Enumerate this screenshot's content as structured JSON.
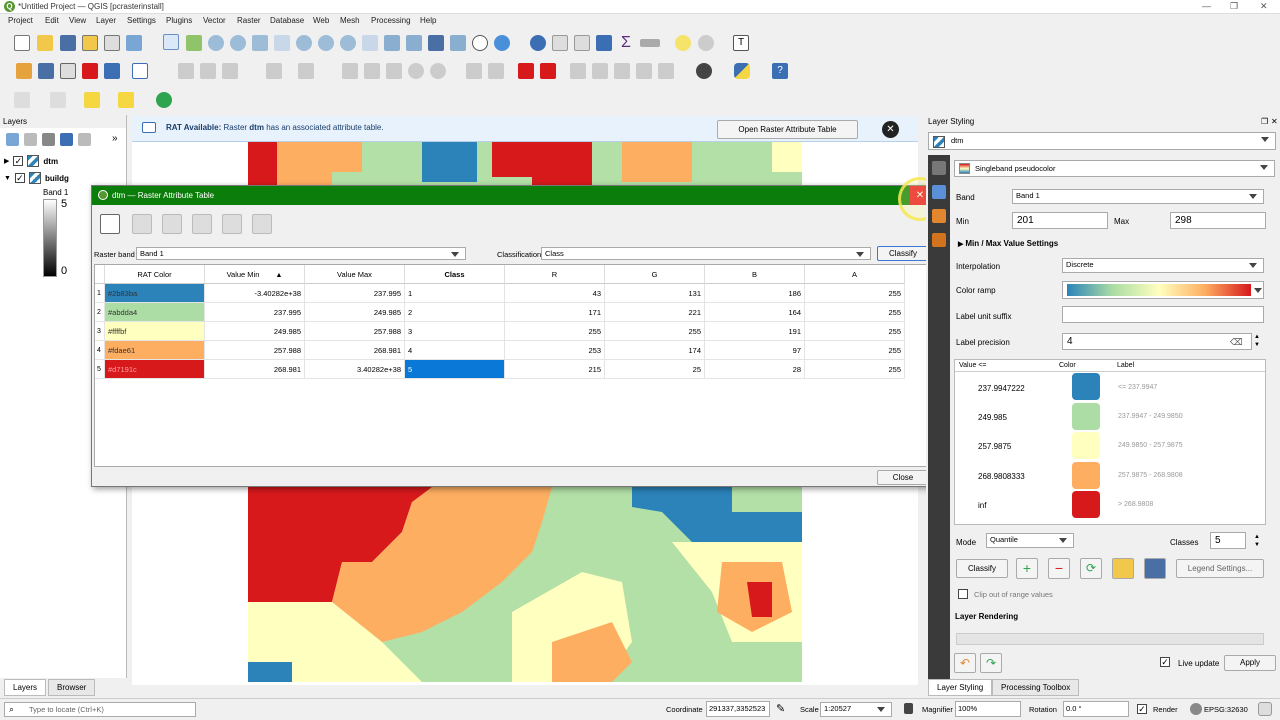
{
  "window": {
    "title": "*Untitled Project — QGIS [pcrasterinstall]"
  },
  "menu": [
    "Project",
    "Edit",
    "View",
    "Layer",
    "Settings",
    "Plugins",
    "Vector",
    "Raster",
    "Database",
    "Web",
    "Mesh",
    "Processing",
    "Help"
  ],
  "layers_panel": {
    "title": "Layers",
    "items": [
      {
        "name": "dtm",
        "checked": true
      },
      {
        "name": "buildg",
        "checked": true
      }
    ],
    "legend": {
      "band": "Band 1",
      "max": "5",
      "min": "0"
    },
    "tabs": [
      "Layers",
      "Browser"
    ]
  },
  "message_bar": {
    "bold": "RAT Available:",
    "text": " Raster ",
    "layer": "dtm",
    "rest": " has an associated attribute table.",
    "button": "Open Raster Attribute Table"
  },
  "dialog": {
    "title": "dtm — Raster Attribute Table",
    "raster_band_label": "Raster band",
    "raster_band": "Band 1",
    "classification_label": "Classification",
    "classification": "Class",
    "classify_button": "Classify",
    "close_button": "Close",
    "columns": [
      "RAT Color",
      "Value Min",
      "Value Max",
      "Class",
      "R",
      "G",
      "B",
      "A"
    ],
    "rows": [
      {
        "n": "1",
        "color": "#2b83ba",
        "min": "-3.40282e+38",
        "max": "237.995",
        "class": "1",
        "r": "43",
        "g": "131",
        "b": "186",
        "a": "255"
      },
      {
        "n": "2",
        "color": "#abdda4",
        "min": "237.995",
        "max": "249.985",
        "class": "2",
        "r": "171",
        "g": "221",
        "b": "164",
        "a": "255"
      },
      {
        "n": "3",
        "color": "#ffffbf",
        "min": "249.985",
        "max": "257.988",
        "class": "3",
        "r": "255",
        "g": "255",
        "b": "191",
        "a": "255"
      },
      {
        "n": "4",
        "color": "#fdae61",
        "min": "257.988",
        "max": "268.981",
        "class": "4",
        "r": "253",
        "g": "174",
        "b": "97",
        "a": "255"
      },
      {
        "n": "5",
        "color": "#d7191c",
        "min": "268.981",
        "max": "3.40282e+38",
        "class": "5",
        "r": "215",
        "g": "25",
        "b": "28",
        "a": "255"
      }
    ]
  },
  "styling": {
    "title": "Layer Styling",
    "layer": "dtm",
    "renderer": "Singleband pseudocolor",
    "band_label": "Band",
    "band": "Band 1",
    "min_label": "Min",
    "min": "201",
    "max_label": "Max",
    "max": "298",
    "minmax_settings": "Min / Max Value Settings",
    "interpolation_label": "Interpolation",
    "interpolation": "Discrete",
    "color_ramp_label": "Color ramp",
    "label_unit_suffix": "Label unit suffix",
    "label_precision_label": "Label precision",
    "label_precision": "4",
    "table_headers": [
      "Value <=",
      "Color",
      "Label"
    ],
    "classes": [
      {
        "value": "237.9947222",
        "color": "#2b83ba",
        "label": "<= 237.9947"
      },
      {
        "value": "249.985",
        "color": "#abdda4",
        "label": "237.9947 - 249.9850"
      },
      {
        "value": "257.9875",
        "color": "#ffffbf",
        "label": "249.9850 - 257.9875"
      },
      {
        "value": "268.9808333",
        "color": "#fdae61",
        "label": "257.9875 - 268.9808"
      },
      {
        "value": "inf",
        "color": "#d7191c",
        "label": "> 268.9808"
      }
    ],
    "mode_label": "Mode",
    "mode": "Quantile",
    "classes_label": "Classes",
    "classes_count": "5",
    "classify_button": "Classify",
    "legend_settings": "Legend Settings...",
    "clip": "Clip out of range values",
    "layer_rendering": "Layer Rendering",
    "live_update": "Live update",
    "apply": "Apply",
    "tabs": [
      "Layer Styling",
      "Processing Toolbox"
    ]
  },
  "status": {
    "locate_placeholder": "Type to locate (Ctrl+K)",
    "coordinate_label": "Coordinate",
    "coordinate": "291337,3352523",
    "scale_label": "Scale",
    "scale": "1:20527",
    "magnifier_label": "Magnifier",
    "magnifier": "100%",
    "rotation_label": "Rotation",
    "rotation": "0.0 °",
    "render": "Render",
    "crs": "EPSG:32630"
  }
}
